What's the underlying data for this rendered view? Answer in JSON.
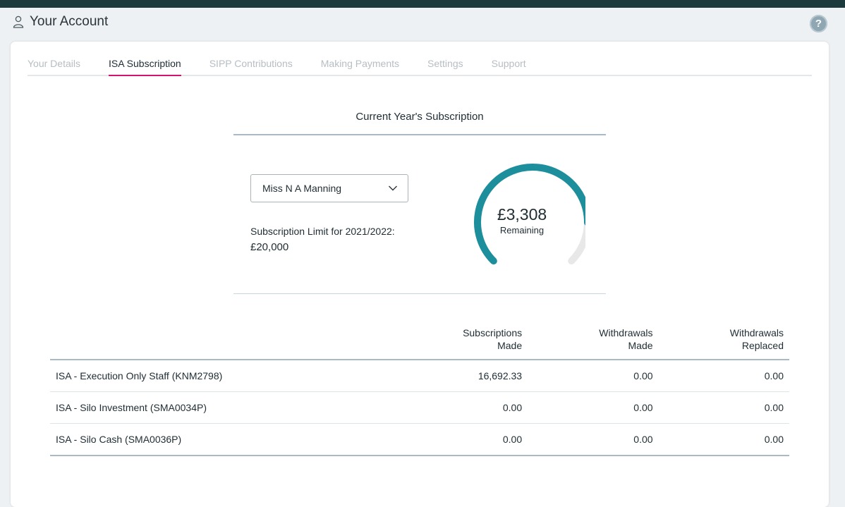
{
  "header": {
    "title": "Your Account",
    "help_label": "?"
  },
  "tabs": [
    {
      "label": "Your Details"
    },
    {
      "label": "ISA Subscription"
    },
    {
      "label": "SIPP Contributions"
    },
    {
      "label": "Making Payments"
    },
    {
      "label": "Settings"
    },
    {
      "label": "Support"
    }
  ],
  "active_tab": "ISA Subscription",
  "subscription": {
    "title": "Current Year's Subscription",
    "account_holder": "Miss N A Manning",
    "limit_label": "Subscription Limit for 2021/2022:",
    "limit_value": "£20,000",
    "remaining_amount": "£3,308",
    "remaining_label": "Remaining",
    "used_fraction": 0.835
  },
  "table": {
    "headers": {
      "subscriptions": [
        "Subscriptions",
        "Made"
      ],
      "withdrawals_made": [
        "Withdrawals",
        "Made"
      ],
      "withdrawals_replaced": [
        "Withdrawals",
        "Replaced"
      ]
    },
    "rows": [
      {
        "account": "ISA - Execution Only Staff (KNM2798)",
        "subscriptions": "16,692.33",
        "withdrawals_made": "0.00",
        "withdrawals_replaced": "0.00"
      },
      {
        "account": "ISA - Silo Investment (SMA0034P)",
        "subscriptions": "0.00",
        "withdrawals_made": "0.00",
        "withdrawals_replaced": "0.00"
      },
      {
        "account": "ISA - Silo Cash (SMA0036P)",
        "subscriptions": "0.00",
        "withdrawals_made": "0.00",
        "withdrawals_replaced": "0.00"
      }
    ]
  },
  "colors": {
    "accent": "#d4136f",
    "gauge_fill": "#1d8e9b",
    "gauge_track": "#e8e8e8",
    "topbar": "#1b3a3e"
  },
  "icons": {
    "user": "user-icon",
    "help": "help-icon",
    "dropdown": "chevron-down-icon"
  }
}
